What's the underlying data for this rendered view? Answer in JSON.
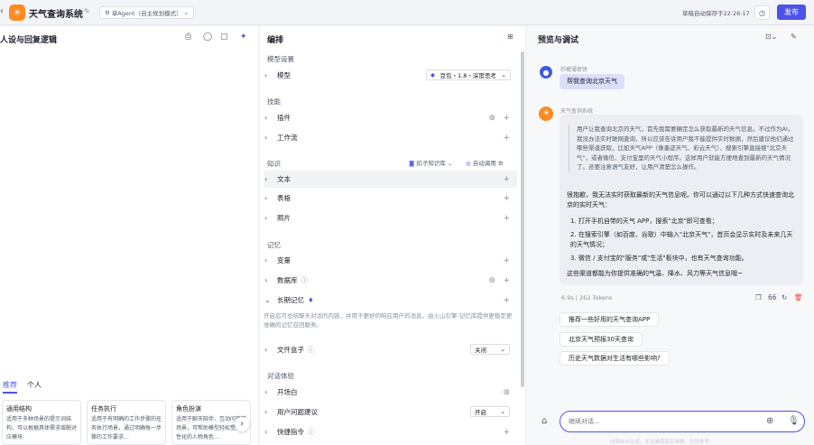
{
  "topbar": {
    "app_name": "天气查询系统",
    "agent_mode": "单Agent（自主规划模式）",
    "autosave": "草稿自动保存于22:26:17",
    "publish": "发布"
  },
  "left": {
    "title": "人设与回复逻辑",
    "tabs": [
      "推荐",
      "个人"
    ],
    "cards": [
      {
        "title": "通用结构",
        "desc": "适用于多种场景的提示词结构，可以根据具体需求增删对应模块"
      },
      {
        "title": "任务执行",
        "desc": "适用于有明确的工作步骤的任务执行场景，通过明确每一步骤的工作要求…"
      },
      {
        "title": "角色扮演",
        "desc": "适用于聊天陪伴、互动问答等场景，可帮助模型轻松塑造个性化的人物角色…"
      }
    ]
  },
  "middle": {
    "title": "编排",
    "model_section": "模型设置",
    "model_label": "模型",
    "model_value": "豆包・1.8・深度思考",
    "skills_section": "技能",
    "plugin": "插件",
    "workflow": "工作流",
    "knowledge_section": "知识",
    "kb_dropdown": "扣子知识库",
    "auto_call": "自动调用",
    "text": "文本",
    "table": "表格",
    "photo": "照片",
    "memory_section": "记忆",
    "variable": "变量",
    "database": "数据库",
    "ltm": "长期记忆",
    "ltm_desc": "开启后可总结聊天对话的内容，并用于更好的响应用户的消息。由火山引擎-记忆库提供更稳定更准确的记忆召回服务。",
    "filebox": "文件盒子",
    "filebox_value": "关闭",
    "dialog_section": "对话体验",
    "opening": "开场白",
    "user_q": "用户问题建议",
    "user_q_value": "开启",
    "shortcut": "快捷指令"
  },
  "right": {
    "title": "预览与调试",
    "user_name": "柠檬薄荷饼",
    "user_msg": "帮我查询北京天气",
    "bot_name": "天气查询系统",
    "thinking": "用户让我查询北京的天气，首先我需要确定怎么获取最新的天气信息。不过作为AI，我没办法实时联网查询，所以应该告诉用户我不能提供实时数据，然后建议他们通过哪些渠道获取，比如天气APP（像墨迹天气、彩云天气）、搜索引擎直接搜\"北京天气\"，或者微信、支付宝里的天气小程序。这样用户就能方便地查到最新的天气情况了。还要注意语气友好，让用户清楚怎么操作。",
    "answer_intro": "很抱歉，我无法实时获取最新的天气信息呢。你可以通过以下几种方式快速查询北京的实时天气：",
    "answer_items": [
      "1. 打开手机自带的天气 APP，搜索\"北京\"即可查看；",
      "2. 在搜索引擎（如百度、谷歌）中输入\"北京天气\"，首页会显示实时及未来几天的天气情况；",
      "3. 微信 / 支付宝的\"服务\"或\"生活\"板块中，也有天气查询功能。"
    ],
    "answer_outro": "这些渠道都能为你提供准确的气温、降水、风力等天气信息哦~",
    "stats": "6.9s | 262 Tokens",
    "suggestions": [
      "推荐一些好用的天气查询APP",
      "北京天气预报30天查询",
      "历史天气数据对生活有哪些影响?"
    ],
    "input_placeholder": "继续对话...",
    "footer": "内容由AI生成，无法确保真实准确，仅供参考。"
  }
}
